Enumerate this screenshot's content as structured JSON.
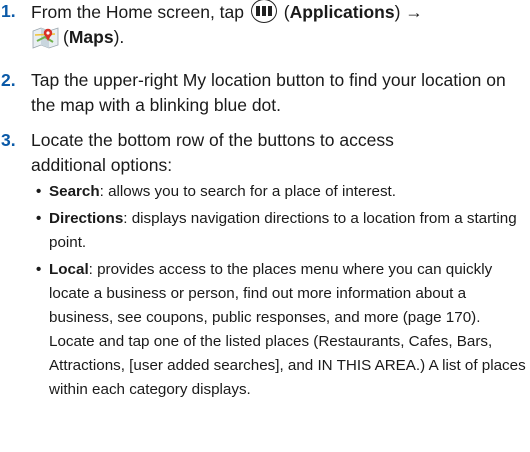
{
  "steps": [
    {
      "number": "1.",
      "parts": {
        "text1": "From the Home screen, tap",
        "apps_label": "Applications",
        "arrow": "→",
        "maps_label": "Maps",
        "period": "."
      }
    },
    {
      "number": "2.",
      "text": "Tap the upper-right My location button to find your location on the map with a blinking blue dot."
    },
    {
      "number": "3.",
      "text": "Locate the bottom row of the buttons to access additional options:"
    }
  ],
  "options": [
    {
      "bullet": "•",
      "term": "Search",
      "desc": ": allows you to search for a place of interest."
    },
    {
      "bullet": "•",
      "term": "Directions",
      "desc": ": displays navigation directions to a location from a starting point."
    },
    {
      "bullet": "•",
      "term": "Local",
      "desc": ": provides access to the places menu where you can quickly locate a business or person, find out more information about a business, see coupons, public responses, and more (page 170). Locate and tap one of the listed places (Restaurants, Cafes, Bars, Attractions, [user added searches], and IN THIS AREA.) A list of places within each category displays."
    }
  ],
  "icons": {
    "applications": "applications-grid-icon",
    "maps": "maps-app-icon"
  },
  "colors": {
    "step_number": "#0a5aa8"
  }
}
